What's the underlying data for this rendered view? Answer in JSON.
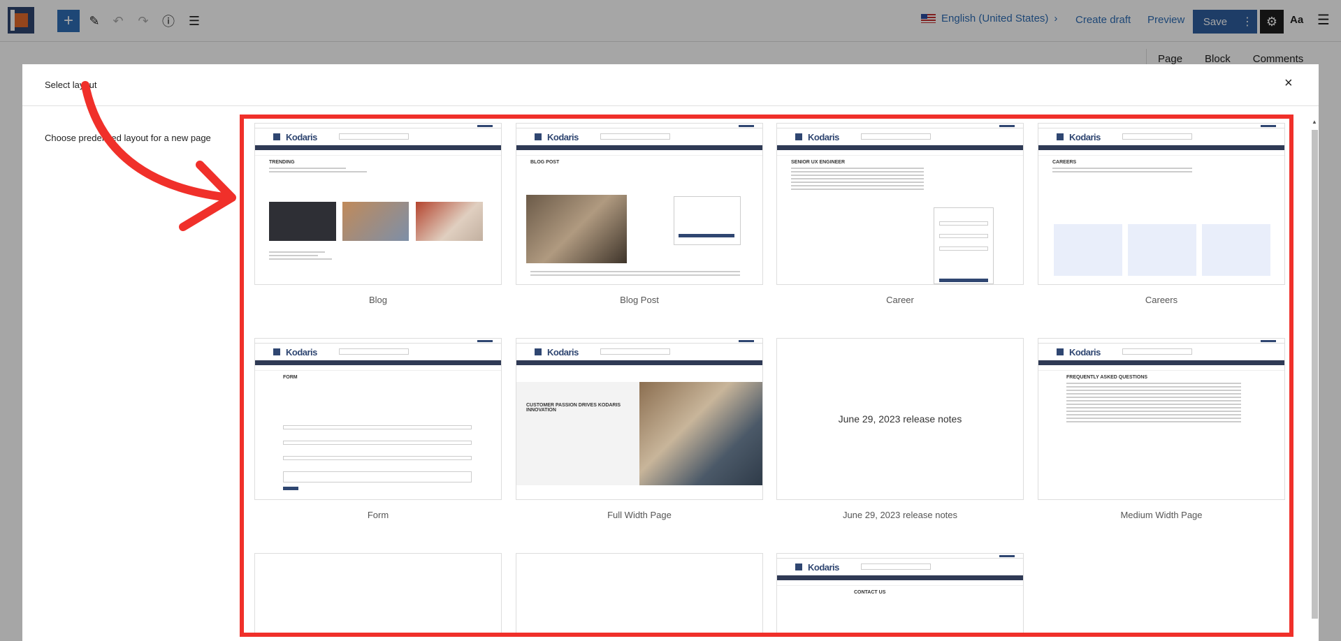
{
  "toolbar": {
    "language": "English (United States)",
    "create_draft": "Create draft",
    "preview": "Preview",
    "save": "Save",
    "typography": "Aa",
    "side_tabs": [
      "Page",
      "Block",
      "Comments"
    ]
  },
  "modal": {
    "title": "Select layout",
    "description": "Choose predefined layout for a new page",
    "close_label": "×"
  },
  "layouts": [
    {
      "label": "Blog"
    },
    {
      "label": "Blog Post"
    },
    {
      "label": "Career"
    },
    {
      "label": "Careers"
    },
    {
      "label": "Form"
    },
    {
      "label": "Full Width Page"
    },
    {
      "label": "June 29, 2023 release notes",
      "preview_text": "June 29, 2023 release notes"
    },
    {
      "label": "Medium Width Page"
    }
  ],
  "thumb_text": {
    "brand": "Kodaris",
    "blog": "Trending",
    "blog_post": "Blog Post",
    "career": "Senior UX Engineer",
    "careers": "Careers",
    "form": "Form",
    "full_width": "Customer Passion Drives Kodaris Innovation",
    "faq": "Frequently Asked Questions",
    "contact": "Contact Us"
  },
  "colors": {
    "accent": "#2f6eb5",
    "navy": "#2f4671",
    "highlight": "#f0302a"
  }
}
